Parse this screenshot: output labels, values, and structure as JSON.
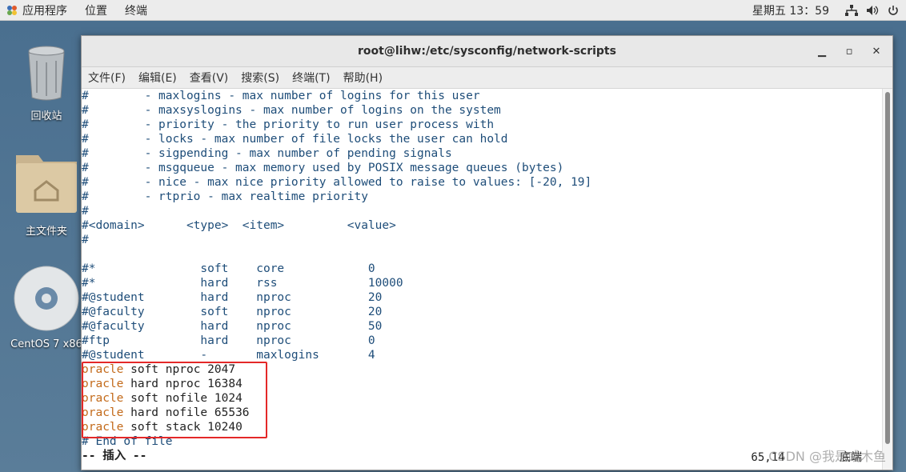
{
  "top_panel": {
    "menu": [
      "应用程序",
      "位置",
      "终端"
    ],
    "clock": "星期五 13：59"
  },
  "desktop": {
    "icons": [
      {
        "name": "trash",
        "label": "回收站"
      },
      {
        "name": "home-folder",
        "label": "主文件夹"
      },
      {
        "name": "cd",
        "label": "CentOS 7 x86"
      }
    ]
  },
  "window": {
    "title": "root@lihw:/etc/sysconfig/network-scripts",
    "menu": [
      "文件(F)",
      "编辑(E)",
      "查看(V)",
      "搜索(S)",
      "终端(T)",
      "帮助(H)"
    ]
  },
  "terminal": {
    "comment_lines": [
      "#        - maxlogins - max number of logins for this user",
      "#        - maxsyslogins - max number of logins on the system",
      "#        - priority - the priority to run user process with",
      "#        - locks - max number of file locks the user can hold",
      "#        - sigpending - max number of pending signals",
      "#        - msgqueue - max memory used by POSIX message queues (bytes)",
      "#        - nice - max nice priority allowed to raise to values: [-20, 19]",
      "#        - rtprio - max realtime priority",
      "#",
      "#<domain>      <type>  <item>         <value>",
      "#",
      "",
      "#*               soft    core            0",
      "#*               hard    rss             10000",
      "#@student        hard    nproc           20",
      "#@faculty        soft    nproc           20",
      "#@faculty        hard    nproc           50",
      "#ftp             hard    nproc           0",
      "#@student        -       maxlogins       4"
    ],
    "oracle_lines": [
      {
        "kw": "oracle",
        "rest": " soft nproc 2047"
      },
      {
        "kw": "oracle",
        "rest": " hard nproc 16384"
      },
      {
        "kw": "oracle",
        "rest": " soft nofile 1024"
      },
      {
        "kw": "oracle",
        "rest": " hard nofile 65536"
      },
      {
        "kw": "oracle",
        "rest": " soft stack 10240"
      }
    ],
    "end_line": "# End of file",
    "status_line": "-- 插入 --",
    "cursor_pos": "65,14",
    "scroll_pos": "底端",
    "watermark": "CSDN @我是咸木鱼"
  }
}
